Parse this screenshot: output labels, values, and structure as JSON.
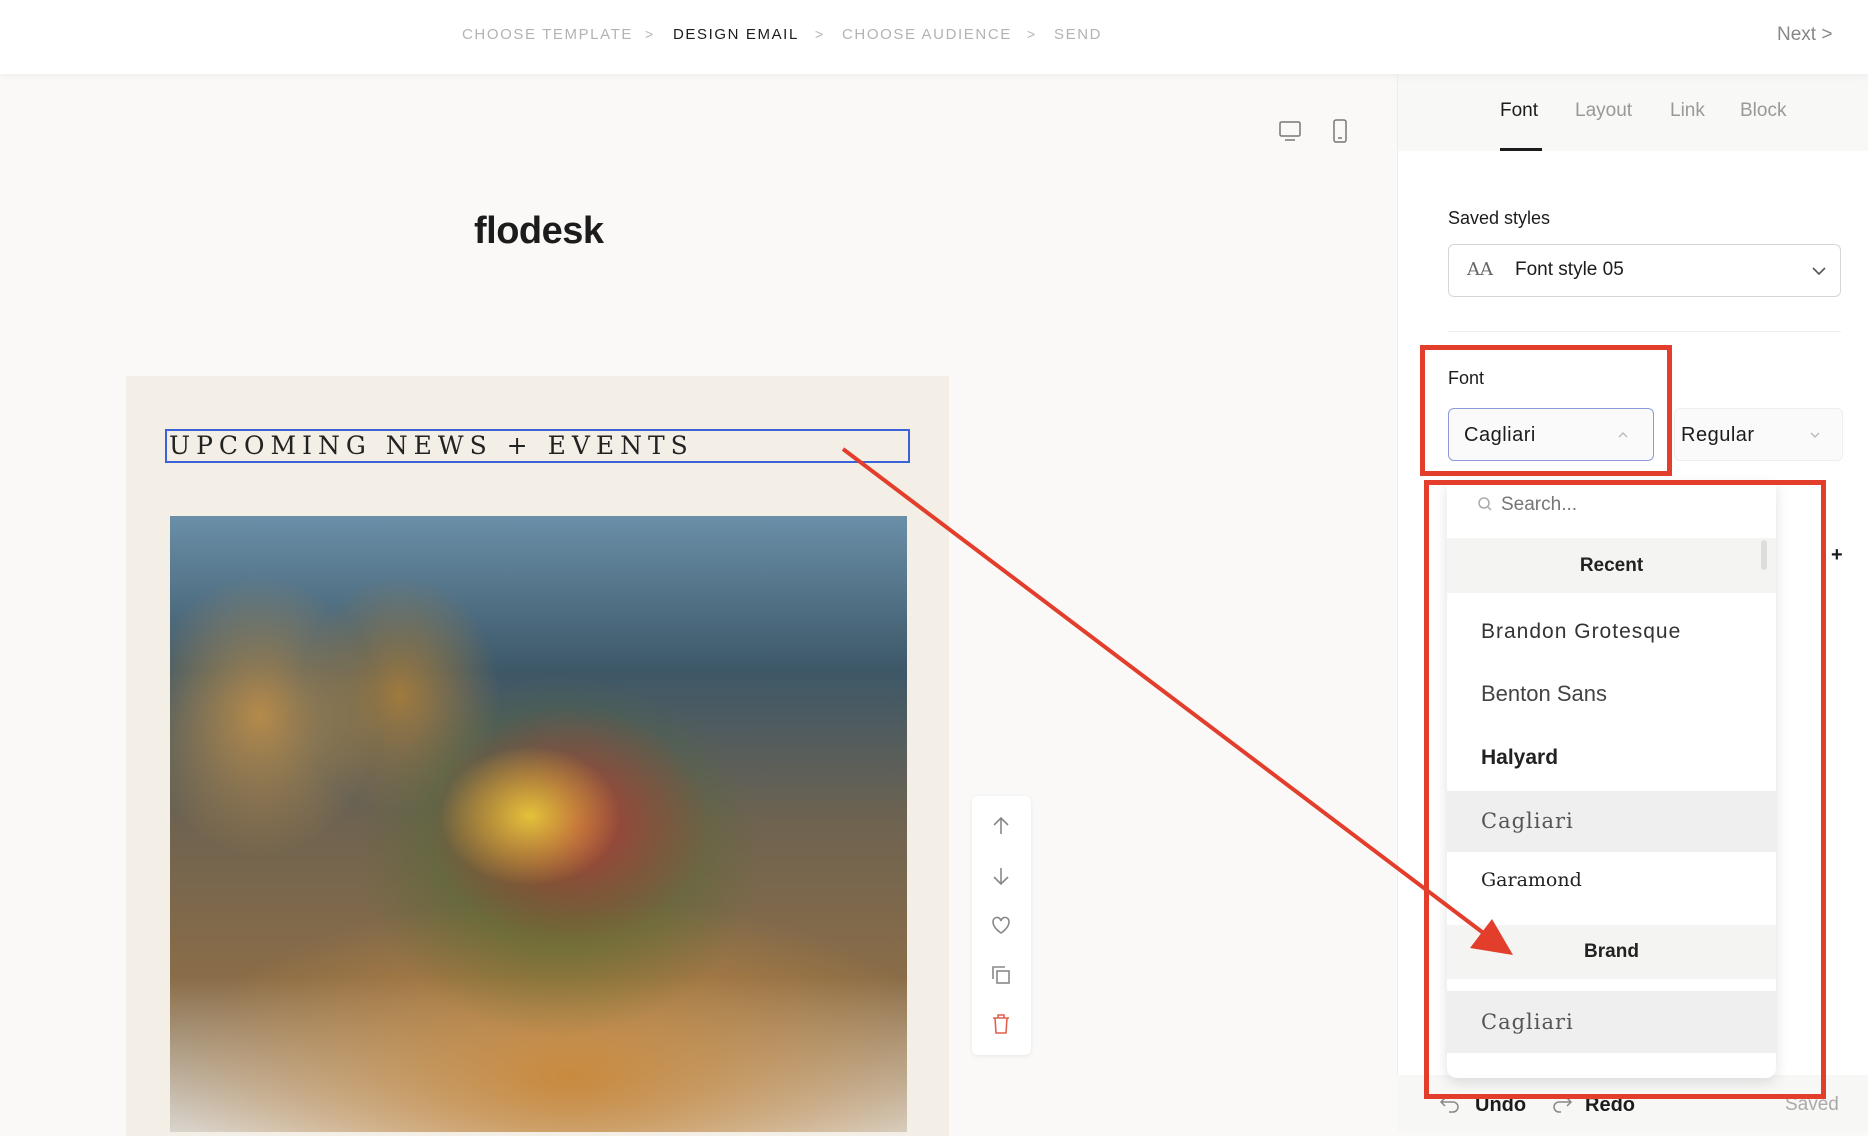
{
  "steps": [
    "CHOOSE TEMPLATE",
    "DESIGN EMAIL",
    "CHOOSE AUDIENCE",
    "SEND"
  ],
  "step_separator": ">",
  "next_label": "Next",
  "next_chevron": ">",
  "logo": "flodesk",
  "email": {
    "heading": "UPCOMING NEWS + EVENTS"
  },
  "panel": {
    "tabs": [
      "Font",
      "Layout",
      "Link",
      "Block"
    ],
    "saved_styles_label": "Saved styles",
    "saved_style_icon": "AA",
    "saved_style_value": "Font style 05",
    "font_label": "Font",
    "font_value": "Cagliari",
    "weight_value": "Regular",
    "search_placeholder": "Search...",
    "recent_header": "Recent",
    "recent_fonts": [
      "Brandon Grotesque",
      "Benton Sans",
      "Halyard",
      "Cagliari",
      "Garamond"
    ],
    "brand_header": "Brand",
    "brand_fonts": [
      "Cagliari"
    ],
    "plus": "+",
    "undo": "Undo",
    "redo": "Redo",
    "status": "Saved"
  },
  "colors": {
    "annotation": "#e23e2b",
    "selection": "#3b62d6"
  }
}
